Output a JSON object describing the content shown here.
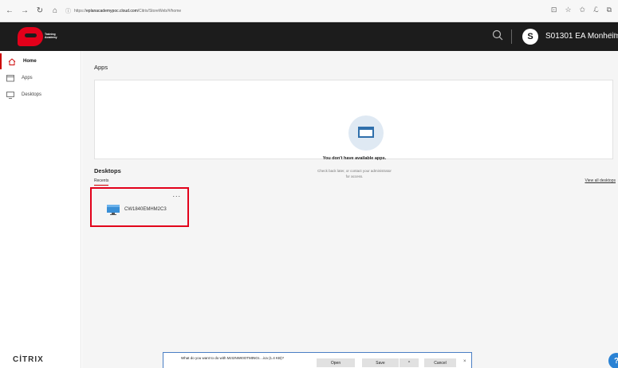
{
  "browser": {
    "url_prefix": "https://",
    "url_domain": "eplanacademypoc.cloud.com",
    "url_path": "/Citrix/StoreWeb/#/home",
    "nav": {
      "back": "←",
      "forward": "→",
      "refresh": "↻",
      "home": "⌂"
    },
    "tools": [
      "⊡",
      "☆",
      "✩",
      "ℒ",
      "⧉"
    ]
  },
  "header": {
    "logo_text_line1": "Training",
    "logo_text_line2": "Academy",
    "avatar_letter": "S",
    "user_name": "S01301 EA Monheim",
    "chevron": "﹀"
  },
  "sidebar": {
    "items": [
      {
        "label": "Home",
        "icon": "home-icon",
        "active": true
      },
      {
        "label": "Apps",
        "icon": "apps-icon",
        "active": false
      },
      {
        "label": "Desktops",
        "icon": "desktop-icon",
        "active": false
      }
    ],
    "brand": "CİTRIX"
  },
  "main": {
    "apps_title": "Apps",
    "empty_title": "You don't have available apps.",
    "empty_sub_line1": "Check back later, or contact your administrator",
    "empty_sub_line2": "for access.",
    "desktops_title": "Desktops",
    "recents_tab": "Recents",
    "view_all": "View all desktops",
    "desktop": {
      "name": "CW1840EMHM2C3",
      "more": "..."
    }
  },
  "download": {
    "text": "What do you want to do with MzI2NWI0OTMtNGI....ica (1.4 KB)?",
    "open": "Open",
    "save": "Save",
    "more": "^",
    "cancel": "Cancel",
    "close": "×"
  },
  "colors": {
    "accent": "#e2001a",
    "header_bg": "#1c1c1c",
    "link_blue": "#2a82d4"
  }
}
